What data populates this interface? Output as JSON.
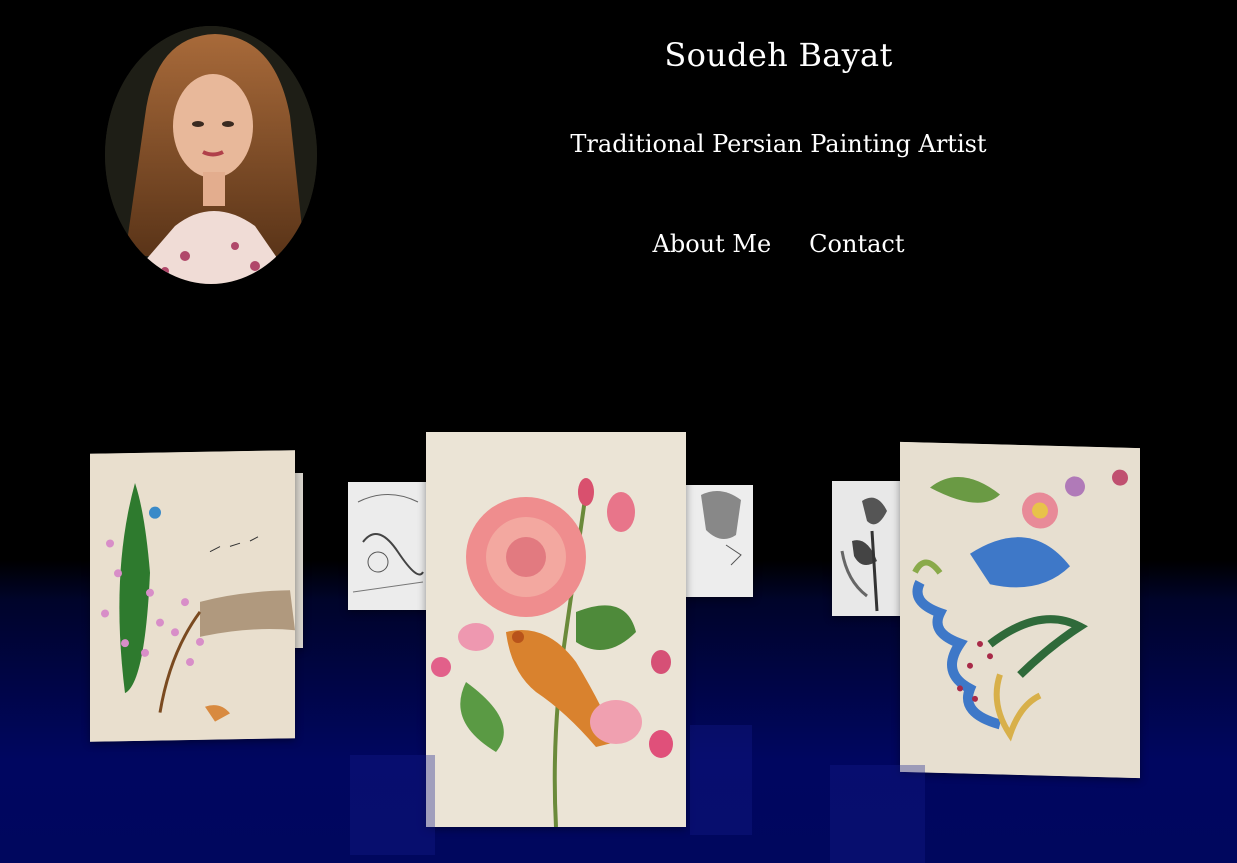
{
  "header": {
    "name": "Soudeh Bayat",
    "subtitle": "Traditional Persian Painting Artist",
    "nav": [
      {
        "label": "About Me"
      },
      {
        "label": "Contact"
      }
    ]
  },
  "gallery": {
    "paintings": [
      {
        "subject": "cypress-blossom-birds"
      },
      {
        "subject": "sketch-figures"
      },
      {
        "subject": "rose-and-bird"
      },
      {
        "subject": "sketch-portrait"
      },
      {
        "subject": "iris-sketch"
      },
      {
        "subject": "islimi-floral"
      }
    ]
  },
  "colors": {
    "background_top": "#000000",
    "floor": "#000660",
    "text": "#ffffff",
    "paper": "#e8e0d2"
  }
}
